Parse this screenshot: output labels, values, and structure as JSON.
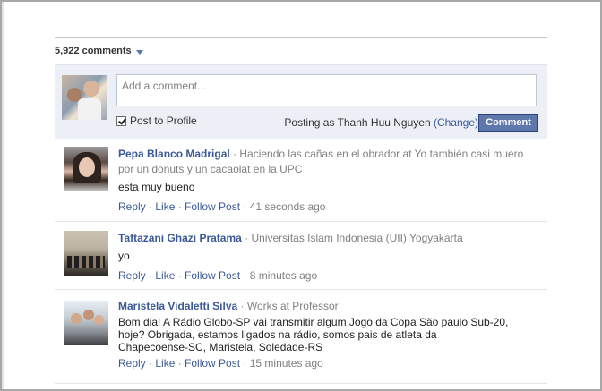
{
  "header": {
    "count_label": "5,922 comments"
  },
  "composer": {
    "placeholder": "Add a comment...",
    "post_to_profile": "Post to Profile",
    "posting_as_prefix": "Posting as Thanh Huu Nguyen",
    "change_link": "(Change)",
    "comment_button": "Comment"
  },
  "comments": [
    {
      "name": "Pepa Blanco Madrigal",
      "meta_line1": "· Haciendo las cañas en el obrador",
      "at": "at",
      "meta_link_line1": "Yo también casi muero",
      "meta_link_line2": "por un donuts y un cacaolat en la UPC",
      "text": "esta muy bueno",
      "reply": "Reply",
      "like": "Like",
      "follow": "Follow Post",
      "time": "41 seconds ago"
    },
    {
      "name": "Taftazani Ghazi Pratama",
      "meta_line1": "· Universitas Islam Indonesia (UII) Yogyakarta",
      "text": "yo",
      "reply": "Reply",
      "like": "Like",
      "follow": "Follow Post",
      "time": "8 minutes ago"
    },
    {
      "name": "Maristela Vidaletti Silva",
      "meta_line1": "· Works at Professor",
      "text_line1": "Bom dia! A Rádio Globo-SP vai transmitir algum Jogo da Copa São paulo Sub-20,",
      "text_line2": "hoje? Obrigada, estamos ligados na rádio, somos pais de atleta da",
      "text_line3": "Chapecoense-SC, Maristela, Soledade-RS",
      "reply": "Reply",
      "like": "Like",
      "follow": "Follow Post",
      "time": "15 minutes ago"
    }
  ]
}
